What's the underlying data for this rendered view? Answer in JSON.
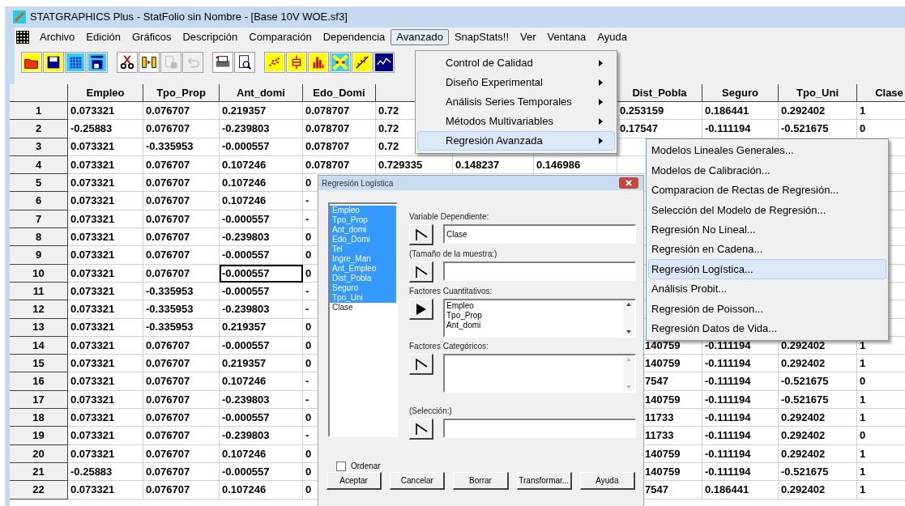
{
  "window": {
    "title": "STATGRAPHICS Plus - StatFolio sin Nombre - [Base 10V WOE.sf3]"
  },
  "menu_bar": [
    {
      "label": "Archivo",
      "selected": false
    },
    {
      "label": "Edición",
      "selected": false
    },
    {
      "label": "Gráficos",
      "selected": false
    },
    {
      "label": "Descripción",
      "selected": false
    },
    {
      "label": "Comparación",
      "selected": false
    },
    {
      "label": "Dependencia",
      "selected": false
    },
    {
      "label": "Avanzado",
      "selected": true
    },
    {
      "label": "SnapStats!!",
      "selected": false
    },
    {
      "label": "Ver",
      "selected": false
    },
    {
      "label": "Ventana",
      "selected": false
    },
    {
      "label": "Ayuda",
      "selected": false
    }
  ],
  "toolbar": [
    {
      "kind": "open",
      "disabled": false
    },
    {
      "kind": "save",
      "disabled": false
    },
    {
      "kind": "grid",
      "disabled": false
    },
    {
      "kind": "numbers",
      "disabled": false
    },
    {
      "kind": "cut",
      "disabled": false
    },
    {
      "kind": "transfer",
      "disabled": false
    },
    {
      "kind": "paste",
      "disabled": true
    },
    {
      "kind": "undo",
      "disabled": true
    },
    {
      "kind": "print",
      "disabled": false
    },
    {
      "kind": "preview",
      "disabled": false
    },
    {
      "kind": "scatter",
      "disabled": false
    },
    {
      "kind": "box",
      "disabled": false
    },
    {
      "kind": "bars",
      "disabled": false
    },
    {
      "kind": "sigma",
      "disabled": false
    },
    {
      "kind": "fit",
      "disabled": false
    },
    {
      "kind": "line",
      "disabled": false
    }
  ],
  "table": {
    "columns_left": [
      "Empleo",
      "Tpo_Prop",
      "Ant_domi",
      "Edo_Domi"
    ],
    "columns_right": [
      "Dist_Pobla",
      "Seguro",
      "Tpo_Uni",
      "Clase"
    ],
    "rows": [
      {
        "number": "1",
        "cells": [
          {
            "text": "0.073321",
            "selected": false
          },
          {
            "text": "0.076707",
            "selected": false
          },
          {
            "text": "0.219357",
            "selected": false
          },
          {
            "text": "0.078707",
            "selected": false
          },
          {
            "text": "0.72",
            "selected": false
          }
        ],
        "tail": [
          "0.253159",
          "0.186441",
          "0.292402",
          "1"
        ]
      },
      {
        "number": "2",
        "cells": [
          {
            "text": "-0.25883",
            "selected": false
          },
          {
            "text": "0.076707",
            "selected": false
          },
          {
            "text": "-0.239803",
            "selected": false
          },
          {
            "text": "0.078707",
            "selected": false
          },
          {
            "text": "0.72",
            "selected": false
          }
        ],
        "tail": [
          "0.17547",
          "-0.111194",
          "-0.521675",
          "0"
        ]
      },
      {
        "number": "3",
        "cells": [
          {
            "text": "0.073321",
            "selected": false
          },
          {
            "text": "-0.335953",
            "selected": false
          },
          {
            "text": "-0.000557",
            "selected": false
          },
          {
            "text": "0.078707",
            "selected": false
          },
          {
            "text": "0.72",
            "selected": false
          }
        ]
      },
      {
        "number": "4",
        "cells": [
          {
            "text": "0.073321",
            "selected": false
          },
          {
            "text": "0.076707",
            "selected": false
          },
          {
            "text": "0.107246",
            "selected": false
          },
          {
            "text": "0.078707",
            "selected": false
          },
          {
            "text": "0.729335",
            "selected": false
          },
          {
            "text": "0.148237",
            "selected": false
          },
          {
            "text": "0.146986",
            "selected": false
          }
        ]
      },
      {
        "number": "5",
        "cells": [
          {
            "text": "0.073321",
            "selected": false
          },
          {
            "text": "0.076707",
            "selected": false
          },
          {
            "text": "0.107246",
            "selected": false
          },
          {
            "text": "0",
            "selected": false
          }
        ]
      },
      {
        "number": "6",
        "cells": [
          {
            "text": "0.073321",
            "selected": false
          },
          {
            "text": "0.076707",
            "selected": false
          },
          {
            "text": "0.107246",
            "selected": false
          },
          {
            "text": "-",
            "selected": false
          }
        ]
      },
      {
        "number": "7",
        "cells": [
          {
            "text": "0.073321",
            "selected": false
          },
          {
            "text": "0.076707",
            "selected": false
          },
          {
            "text": "-0.000557",
            "selected": false
          },
          {
            "text": "-",
            "selected": false
          }
        ]
      },
      {
        "number": "8",
        "cells": [
          {
            "text": "0.073321",
            "selected": false
          },
          {
            "text": "0.076707",
            "selected": false
          },
          {
            "text": "-0.239803",
            "selected": false
          },
          {
            "text": "0",
            "selected": false
          }
        ]
      },
      {
        "number": "9",
        "cells": [
          {
            "text": "0.073321",
            "selected": false
          },
          {
            "text": "0.076707",
            "selected": false
          },
          {
            "text": "-0.000557",
            "selected": false
          },
          {
            "text": "0",
            "selected": false
          }
        ]
      },
      {
        "number": "10",
        "cells": [
          {
            "text": "0.073321",
            "selected": false
          },
          {
            "text": "0.076707",
            "selected": false
          },
          {
            "text": "-0.000557",
            "selected": true
          },
          {
            "text": "0",
            "selected": false
          }
        ]
      },
      {
        "number": "11",
        "cells": [
          {
            "text": "0.073321",
            "selected": false
          },
          {
            "text": "-0.335953",
            "selected": false
          },
          {
            "text": "-0.000557",
            "selected": false
          },
          {
            "text": "-",
            "selected": false
          }
        ]
      },
      {
        "number": "12",
        "cells": [
          {
            "text": "0.073321",
            "selected": false
          },
          {
            "text": "-0.335953",
            "selected": false
          },
          {
            "text": "-0.239803",
            "selected": false
          },
          {
            "text": "-",
            "selected": false
          }
        ]
      },
      {
        "number": "13",
        "cells": [
          {
            "text": "0.073321",
            "selected": false
          },
          {
            "text": "-0.335953",
            "selected": false
          },
          {
            "text": "0.219357",
            "selected": false
          },
          {
            "text": "0",
            "selected": false
          }
        ]
      },
      {
        "number": "14",
        "cells": [
          {
            "text": "0.073321",
            "selected": false
          },
          {
            "text": "0.076707",
            "selected": false
          },
          {
            "text": "-0.000557",
            "selected": false
          },
          {
            "text": "0",
            "selected": false
          }
        ],
        "peek": "140759",
        "tail": [
          "-0.111194",
          "0.292402",
          "1"
        ]
      },
      {
        "number": "15",
        "cells": [
          {
            "text": "0.073321",
            "selected": false
          },
          {
            "text": "0.076707",
            "selected": false
          },
          {
            "text": "0.219357",
            "selected": false
          },
          {
            "text": "0",
            "selected": false
          }
        ],
        "peek": "140759",
        "tail": [
          "-0.111194",
          "0.292402",
          "1"
        ]
      },
      {
        "number": "16",
        "cells": [
          {
            "text": "0.073321",
            "selected": false
          },
          {
            "text": "0.076707",
            "selected": false
          },
          {
            "text": "0.107246",
            "selected": false
          },
          {
            "text": "-",
            "selected": false
          }
        ],
        "peek": "7547",
        "tail": [
          "-0.111194",
          "-0.521675",
          "0"
        ]
      },
      {
        "number": "17",
        "cells": [
          {
            "text": "0.073321",
            "selected": false
          },
          {
            "text": "0.076707",
            "selected": false
          },
          {
            "text": "-0.239803",
            "selected": false
          },
          {
            "text": "-",
            "selected": false
          }
        ],
        "peek": "140759",
        "tail": [
          "-0.111194",
          "-0.521675",
          "1"
        ]
      },
      {
        "number": "18",
        "cells": [
          {
            "text": "0.073321",
            "selected": false
          },
          {
            "text": "0.076707",
            "selected": false
          },
          {
            "text": "-0.000557",
            "selected": false
          },
          {
            "text": "0",
            "selected": false
          }
        ],
        "peek": "11733",
        "tail": [
          "-0.111194",
          "0.292402",
          "1"
        ]
      },
      {
        "number": "19",
        "cells": [
          {
            "text": "0.073321",
            "selected": false
          },
          {
            "text": "0.076707",
            "selected": false
          },
          {
            "text": "-0.239803",
            "selected": false
          },
          {
            "text": "-",
            "selected": false
          }
        ],
        "peek": "11733",
        "tail": [
          "-0.111194",
          "0.292402",
          "0"
        ]
      },
      {
        "number": "20",
        "cells": [
          {
            "text": "0.073321",
            "selected": false
          },
          {
            "text": "0.076707",
            "selected": false
          },
          {
            "text": "0.107246",
            "selected": false
          },
          {
            "text": "0",
            "selected": false
          }
        ],
        "peek": "140759",
        "tail": [
          "-0.111194",
          "0.292402",
          "1"
        ]
      },
      {
        "number": "21",
        "cells": [
          {
            "text": "-0.25883",
            "selected": false
          },
          {
            "text": "0.076707",
            "selected": false
          },
          {
            "text": "-0.000557",
            "selected": false
          },
          {
            "text": "0",
            "selected": false
          }
        ],
        "peek": "140759",
        "tail": [
          "-0.111194",
          "-0.521675",
          "1"
        ]
      },
      {
        "number": "22",
        "cells": [
          {
            "text": "0.073321",
            "selected": false
          },
          {
            "text": "0.076707",
            "selected": false
          },
          {
            "text": "0.107246",
            "selected": false
          },
          {
            "text": "0",
            "selected": false
          }
        ],
        "peek": "7547",
        "tail": [
          "0.186441",
          "0.292402",
          "1"
        ]
      }
    ]
  },
  "menu": {
    "items": [
      {
        "label": "Control de Calidad",
        "selected": false
      },
      {
        "label": "Diseño Experimental",
        "selected": false
      },
      {
        "label": "Análisis Series Temporales",
        "selected": false
      },
      {
        "label": "Métodos Multivariables",
        "selected": false
      },
      {
        "label": "Regresión Avanzada",
        "selected": true
      }
    ]
  },
  "submenu": {
    "items": [
      {
        "label": "Modelos Lineales Generales...",
        "selected": false
      },
      {
        "label": "Modelos de Calibración...",
        "selected": false
      },
      {
        "label": "Comparacion de Rectas de Regresión...",
        "selected": false
      },
      {
        "label": "Selección del Modelo de Regresión...",
        "selected": false
      },
      {
        "label": "Regresión No Lineal...",
        "selected": false
      },
      {
        "label": "Regresión en Cadena...",
        "selected": false
      },
      {
        "label": "Regresión Logística...",
        "selected": true
      },
      {
        "label": "Análisis Probit...",
        "selected": false
      },
      {
        "label": "Regresión de Poisson...",
        "selected": false
      },
      {
        "label": "Regresión Datos de Vida...",
        "selected": false
      }
    ]
  },
  "dialog": {
    "title": "Regresión Logística",
    "variables": [
      {
        "name": "Empleo",
        "selected": true
      },
      {
        "name": "Tpo_Prop",
        "selected": true
      },
      {
        "name": "Ant_domi",
        "selected": true
      },
      {
        "name": "Edo_Domi",
        "selected": true
      },
      {
        "name": "Tel",
        "selected": true
      },
      {
        "name": "Ingre_Man",
        "selected": true
      },
      {
        "name": "Ant_Empleo",
        "selected": true
      },
      {
        "name": "Dist_Pobla",
        "selected": true
      },
      {
        "name": "Seguro",
        "selected": true
      },
      {
        "name": "Tpo_Uni",
        "selected": true
      },
      {
        "name": "Clase",
        "selected": false
      }
    ],
    "fields": [
      {
        "kind": "line",
        "label": "Variable Dependiente:",
        "value": "Clase",
        "active": false
      },
      {
        "kind": "line",
        "label": "(Tamaño de la muestra:)",
        "active": false
      },
      {
        "kind": "list",
        "label": "Factores Cuantitativos:",
        "items": [
          "Empleo",
          "Tpo_Prop",
          "Ant_domi"
        ],
        "active": true
      },
      {
        "kind": "list",
        "label": "Factores Categóricos:",
        "active": false
      },
      {
        "kind": "line",
        "label": "(Selección:)",
        "active": false
      }
    ],
    "sort": {
      "label": "Ordenar",
      "checked": false
    },
    "buttons": [
      "Aceptar",
      "Cancelar",
      "Borrar",
      "Transformar...",
      "Ayuda"
    ]
  }
}
